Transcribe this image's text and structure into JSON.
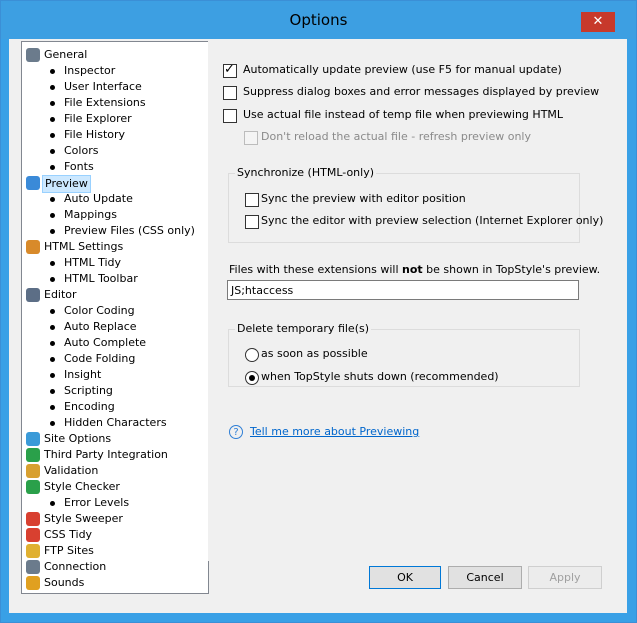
{
  "window": {
    "title": "Options",
    "close_glyph": "✕"
  },
  "tree": {
    "items": [
      {
        "label": "General",
        "level": 0,
        "icon": "wrench-icon"
      },
      {
        "label": "Inspector",
        "level": 1
      },
      {
        "label": "User Interface",
        "level": 1
      },
      {
        "label": "File Extensions",
        "level": 1
      },
      {
        "label": "File Explorer",
        "level": 1
      },
      {
        "label": "File History",
        "level": 1
      },
      {
        "label": "Colors",
        "level": 1
      },
      {
        "label": "Fonts",
        "level": 1
      },
      {
        "label": "Preview",
        "level": 0,
        "icon": "preview-icon",
        "selected": true
      },
      {
        "label": "Auto Update",
        "level": 1
      },
      {
        "label": "Mappings",
        "level": 1
      },
      {
        "label": "Preview Files (CSS only)",
        "level": 1
      },
      {
        "label": "HTML Settings",
        "level": 0,
        "icon": "html-icon"
      },
      {
        "label": "HTML Tidy",
        "level": 1
      },
      {
        "label": "HTML Toolbar",
        "level": 1
      },
      {
        "label": "Editor",
        "level": 0,
        "icon": "editor-icon"
      },
      {
        "label": "Color Coding",
        "level": 1
      },
      {
        "label": "Auto Replace",
        "level": 1
      },
      {
        "label": "Auto Complete",
        "level": 1
      },
      {
        "label": "Code Folding",
        "level": 1
      },
      {
        "label": "Insight",
        "level": 1
      },
      {
        "label": "Scripting",
        "level": 1
      },
      {
        "label": "Encoding",
        "level": 1
      },
      {
        "label": "Hidden Characters",
        "level": 1
      },
      {
        "label": "Site Options",
        "level": 0,
        "icon": "site-icon"
      },
      {
        "label": "Third Party Integration",
        "level": 0,
        "icon": "integration-icon"
      },
      {
        "label": "Validation",
        "level": 0,
        "icon": "validation-icon"
      },
      {
        "label": "Style Checker",
        "level": 0,
        "icon": "check-icon"
      },
      {
        "label": "Error Levels",
        "level": 1
      },
      {
        "label": "Style Sweeper",
        "level": 0,
        "icon": "sweeper-icon"
      },
      {
        "label": "CSS Tidy",
        "level": 0,
        "icon": "tidy-icon"
      },
      {
        "label": "FTP Sites",
        "level": 0,
        "icon": "ftp-icon"
      },
      {
        "label": "Connection",
        "level": 0,
        "icon": "connection-icon"
      },
      {
        "label": "Sounds",
        "level": 0,
        "icon": "sounds-icon"
      }
    ]
  },
  "preview": {
    "auto_update": {
      "label": "Automatically update preview (use F5 for manual update)",
      "checked": true
    },
    "suppress_errors": {
      "label": "Suppress dialog boxes and error messages displayed by preview",
      "checked": false
    },
    "use_actual_file": {
      "label": "Use actual file instead of temp file when previewing HTML",
      "checked": false
    },
    "dont_reload": {
      "label": "Don't reload the actual file - refresh preview only",
      "checked": false,
      "disabled": true
    },
    "sync_group": {
      "title": "Synchronize (HTML-only)",
      "sync_editor": {
        "label": "Sync the preview with editor position",
        "checked": false
      },
      "sync_preview": {
        "label": "Sync the editor with preview selection (Internet Explorer only)",
        "checked": false
      }
    },
    "extensions": {
      "label_before": "Files with these extensions will ",
      "label_bold": "not",
      "label_after": " be shown in TopStyle's preview.",
      "value": "JS;htaccess"
    },
    "delete_group": {
      "title": "Delete temporary file(s)",
      "option_asap": {
        "label": "as soon as possible",
        "checked": false
      },
      "option_shutdown": {
        "label": "when TopStyle shuts down (recommended)",
        "checked": true
      }
    },
    "help_link": "Tell me more about Previewing"
  },
  "buttons": {
    "ok": "OK",
    "cancel": "Cancel",
    "apply": "Apply"
  }
}
